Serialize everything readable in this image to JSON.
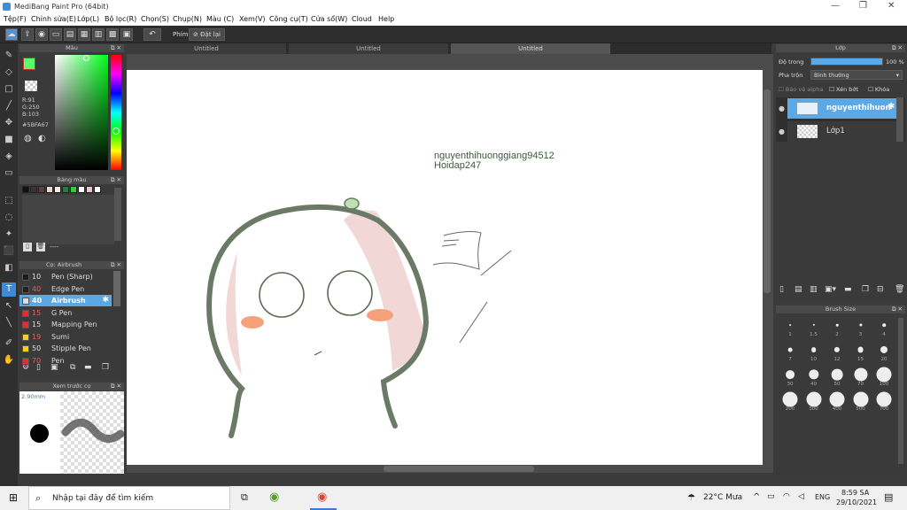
{
  "app": {
    "title": "MediBang Paint Pro (64bit)",
    "min": "—",
    "max": "❐",
    "close": "✕"
  },
  "menu": [
    "Tệp(F)",
    "Chỉnh sửa(E)",
    "Lớp(L)",
    "Bộ lọc(R)",
    "Chọn(S)",
    "Chụp(N)",
    "Màu (C)",
    "Xem(V)",
    "Công cụ(T)",
    "Cửa sổ(W)",
    "Cloud",
    "Help"
  ],
  "toolbar": {
    "phim_label": "Phím",
    "reset_label": "Đặt lại"
  },
  "color_panel": {
    "title": "Màu",
    "r": "R:91",
    "g": "G:250",
    "b": "B:103",
    "hex": "#5BFA67",
    "fg_color": "#5bfa67"
  },
  "palette_panel": {
    "title": "Bảng màu",
    "footer": "----",
    "swatches": [
      "#111111",
      "#3a2f3a",
      "#5b3f46",
      "#e8d8d0",
      "#f7ece4",
      "#2a7a3a",
      "#2bd13b",
      "#ffffff",
      "#f2c6c8",
      "#ffffff"
    ]
  },
  "brush_panel": {
    "title": "Cọ: Airbrush",
    "items": [
      {
        "size": "10",
        "name": "Pen (Sharp)",
        "color": "#1a1a1a",
        "selected": false
      },
      {
        "size": "40",
        "name": "Edge Pen",
        "color": "#222222",
        "selected": false
      },
      {
        "size": "40",
        "name": "Airbrush",
        "color": "#dddddd",
        "selected": true
      },
      {
        "size": "15",
        "name": "G Pen",
        "color": "#e03030",
        "selected": false
      },
      {
        "size": "15",
        "name": "Mapping Pen",
        "color": "#e03030",
        "selected": false
      },
      {
        "size": "19",
        "name": "Sumi",
        "color": "#f0d020",
        "selected": false
      },
      {
        "size": "50",
        "name": "Stipple Pen",
        "color": "#f0d020",
        "selected": false
      },
      {
        "size": "70",
        "name": "Pen",
        "color": "#e03030",
        "selected": false
      }
    ]
  },
  "preview_panel": {
    "title": "Xem trước cọ",
    "size": "2.90mm"
  },
  "tabs": [
    "Untitled",
    "Untitled",
    "Untitled"
  ],
  "canvas": {
    "line1": "nguyenthihuonggiang94512",
    "line2": "Hoidap247"
  },
  "layer_panel": {
    "title": "Lớp",
    "opacity_label": "Độ trong",
    "opacity_value": "100 %",
    "opacity_fraction": 1.0,
    "blend_label": "Pha trộn",
    "blend_value": "Bình thường",
    "protect_alpha": "Bảo vệ alpha",
    "clipping": "Xén bớt",
    "lock": "Khóa",
    "layers": [
      {
        "name": "nguyenthihuon",
        "selected": true
      },
      {
        "name": "Lớp1",
        "selected": false
      }
    ]
  },
  "brush_size_panel": {
    "title": "Brush Size",
    "sizes": [
      "1",
      "1.5",
      "2",
      "3",
      "4",
      "7",
      "10",
      "12",
      "15",
      "20",
      "30",
      "40",
      "50",
      "70",
      "100",
      "200",
      "300",
      "400",
      "500",
      "700"
    ]
  },
  "taskbar": {
    "search_placeholder": "Nhập tại đây để tìm kiếm",
    "weather": "22°C  Mưa",
    "lang": "ENG",
    "time": "8:59 SA",
    "date": "29/10/2021"
  }
}
